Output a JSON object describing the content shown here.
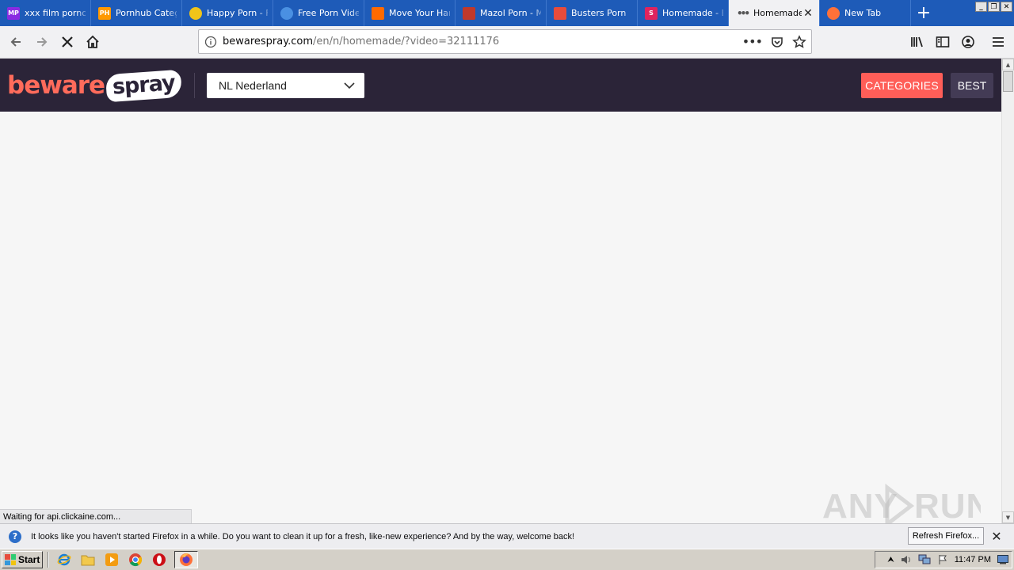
{
  "tabs": [
    {
      "title": "xxx film porno,",
      "favicon": "mp-favicon",
      "favicon_text": "MP",
      "color": "#8a2be2",
      "active": false
    },
    {
      "title": "Pornhub Categ",
      "favicon": "ph-favicon",
      "favicon_text": "PH",
      "color": "#ff9900",
      "active": false
    },
    {
      "title": "Happy Porn - F",
      "favicon": "smiley-favicon",
      "favicon_text": "",
      "color": "#f0c419",
      "active": false
    },
    {
      "title": "Free Porn Vide",
      "favicon": "globe-favicon",
      "favicon_text": "",
      "color": "#4a90e2",
      "active": false
    },
    {
      "title": "Move Your Han",
      "favicon": "m-favicon",
      "favicon_text": "",
      "color": "#ff6a00",
      "active": false
    },
    {
      "title": "Mazol Porn - M",
      "favicon": "mazol-favicon",
      "favicon_text": "",
      "color": "#c0392b",
      "active": false
    },
    {
      "title": "Busters Porn",
      "favicon": "devil-favicon",
      "favicon_text": "",
      "color": "#e74c3c",
      "active": false
    },
    {
      "title": "Homemade - B",
      "favicon": "s-favicon",
      "favicon_text": "S",
      "color": "#e0245e",
      "active": false
    },
    {
      "title": "Homemade",
      "favicon": "loading-dots-favicon",
      "favicon_text": "",
      "color": "#555555",
      "active": true
    },
    {
      "title": "New Tab",
      "favicon": "firefox-favicon",
      "favicon_text": "",
      "color": "#ff7139",
      "active": false
    }
  ],
  "address_bar": {
    "host": "bewarespray.com",
    "path": "/en/n/homemade/?video=32111176"
  },
  "site": {
    "logo_word1": "beware",
    "logo_word2": "spray",
    "language_select": "NL Nederland",
    "categories_label": "CATEGORIES",
    "best_label": "BEST",
    "accent_color": "#ff5e58",
    "header_color": "#2b2438"
  },
  "status_text": "Waiting for api.clickaine.com...",
  "watermark": "ANY RUN",
  "notification": {
    "message": "It looks like you haven't started Firefox in a while. Do you want to clean it up for a fresh, like-new experience? And by the way, welcome back!",
    "button_label": "Refresh Firefox..."
  },
  "taskbar": {
    "start_label": "Start",
    "clock": "11:47 PM"
  }
}
